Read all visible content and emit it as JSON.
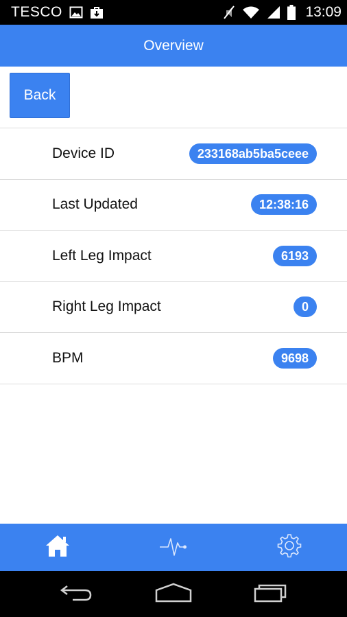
{
  "status_bar": {
    "carrier": "TESCO",
    "time": "13:09",
    "icons": [
      "image-icon",
      "shopping-bag-icon",
      "mute-icon",
      "wifi-icon",
      "signal-icon",
      "battery-icon"
    ]
  },
  "header": {
    "title": "Overview"
  },
  "toolbar": {
    "back_label": "Back"
  },
  "rows": [
    {
      "label": "Device ID",
      "value": "233168ab5ba5ceee"
    },
    {
      "label": "Last Updated",
      "value": "12:38:16"
    },
    {
      "label": "Left Leg Impact",
      "value": "6193"
    },
    {
      "label": "Right Leg Impact",
      "value": "0"
    },
    {
      "label": "BPM",
      "value": "9698"
    }
  ],
  "tabs": [
    {
      "icon": "home-icon",
      "active": true
    },
    {
      "icon": "heartbeat-icon",
      "active": false
    },
    {
      "icon": "settings-gear-icon",
      "active": false
    }
  ],
  "nav_bar": {
    "icons": [
      "back-arrow-icon",
      "home-nav-icon",
      "recent-apps-icon"
    ]
  },
  "colors": {
    "accent": "#3b82f0",
    "status_bar": "#000000",
    "divider": "#dcdcdc",
    "text": "#111111"
  }
}
